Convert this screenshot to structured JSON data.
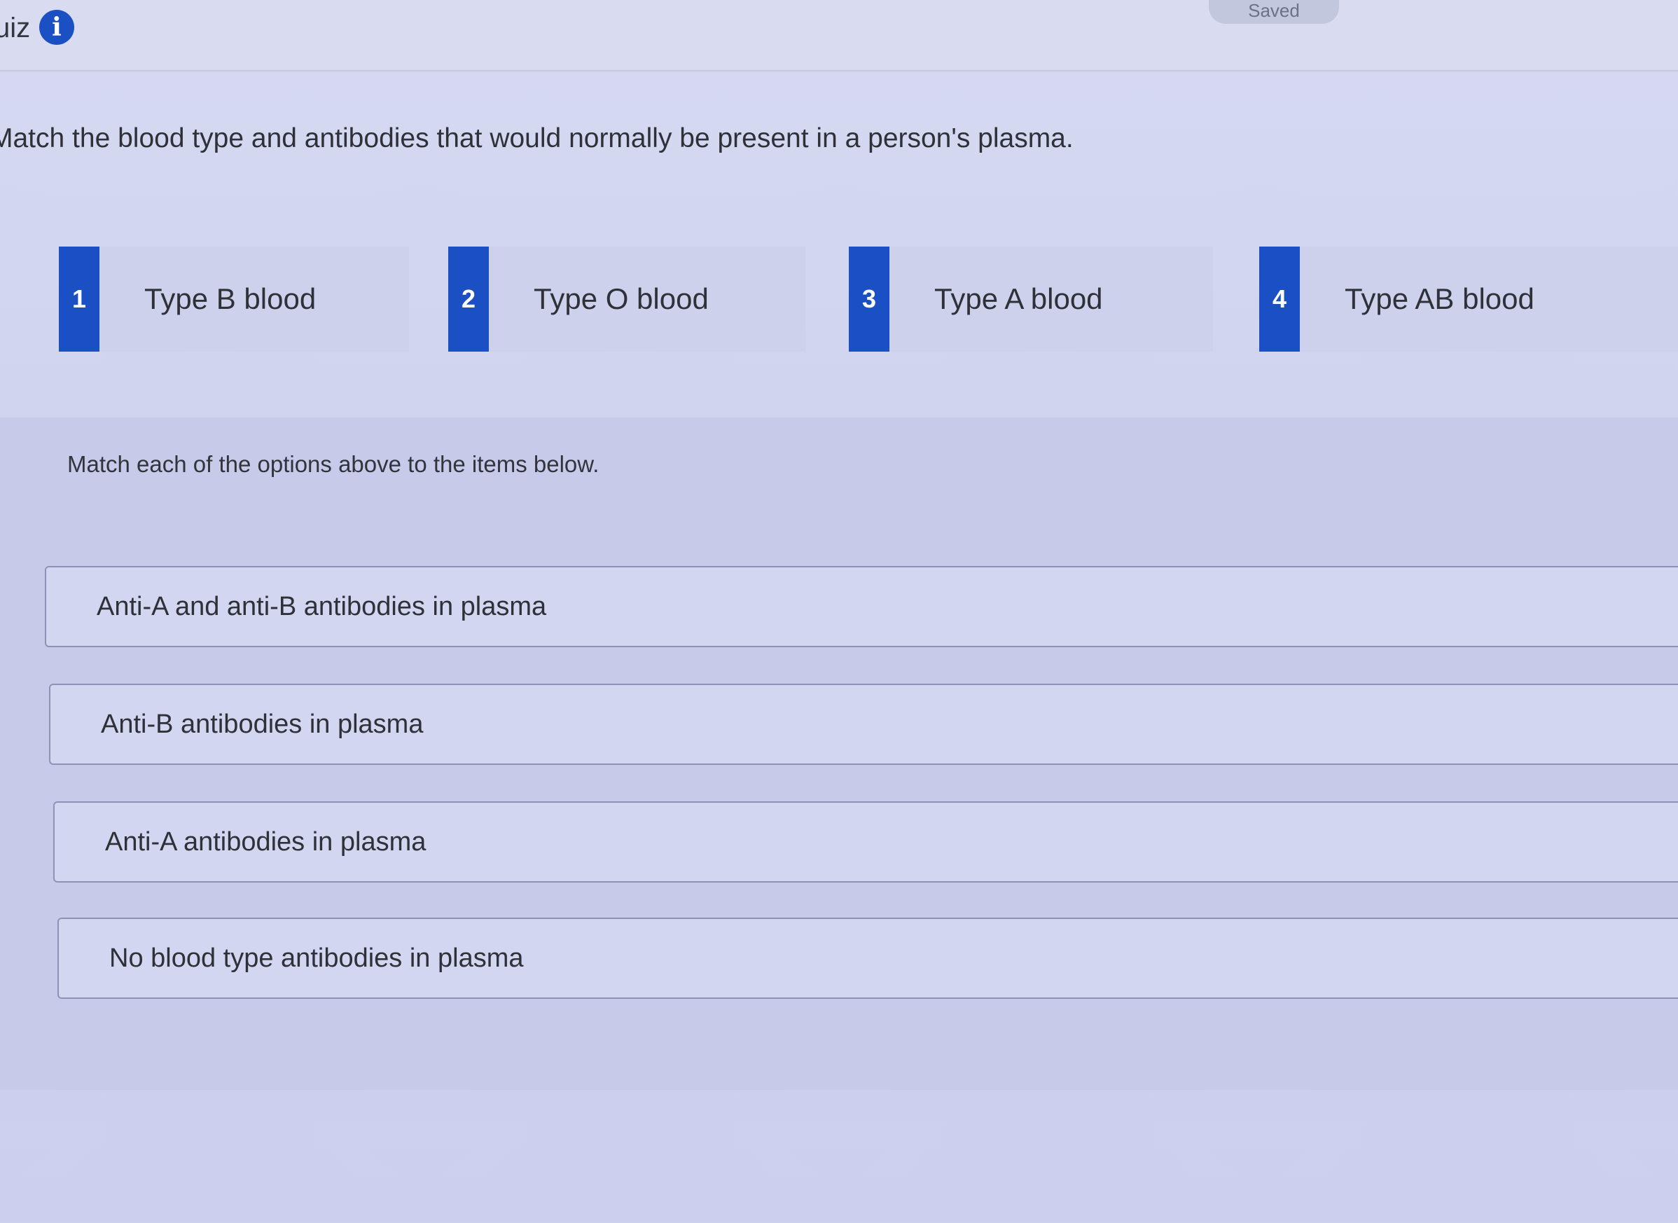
{
  "header": {
    "title": "uiz",
    "info_icon": "info-icon",
    "info_glyph": "i",
    "status_label": "Saved"
  },
  "question": {
    "prompt": "Match the blood type and antibodies that would normally be present in a person's plasma."
  },
  "options": [
    {
      "number": "1",
      "label": "Type B blood"
    },
    {
      "number": "2",
      "label": "Type O blood"
    },
    {
      "number": "3",
      "label": "Type A blood"
    },
    {
      "number": "4",
      "label": "Type AB blood"
    }
  ],
  "match_section": {
    "instruction": "Match each of the options above to the items below.",
    "items": [
      {
        "label": "Anti-A and anti-B antibodies in plasma"
      },
      {
        "label": "Anti-B antibodies in plasma"
      },
      {
        "label": "Anti-A antibodies in plasma"
      },
      {
        "label": "No blood type antibodies in plasma"
      }
    ]
  },
  "colors": {
    "accent": "#1b4fc4",
    "background": "#d6d9f0"
  }
}
